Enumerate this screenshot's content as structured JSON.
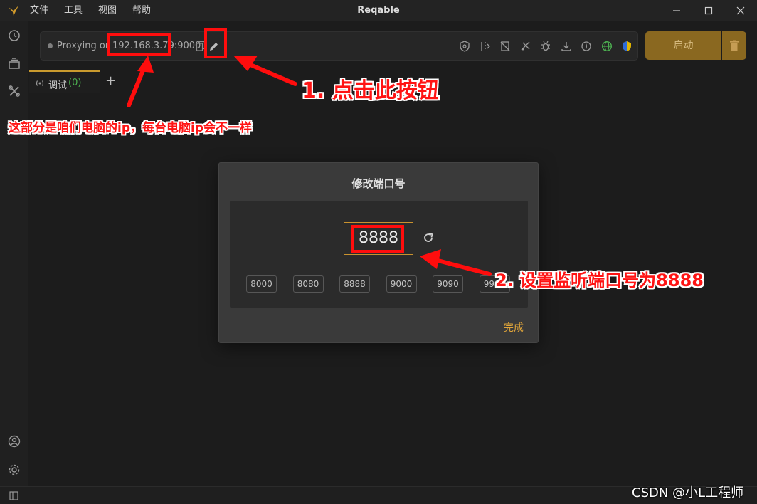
{
  "window": {
    "title": "Reqable",
    "menu": [
      "文件",
      "工具",
      "视图",
      "帮助"
    ]
  },
  "proxy": {
    "label": "Proxying on",
    "address": "192.168.3.79:9000"
  },
  "toolbar": {
    "icons": [
      "ssl-proxy-icon",
      "breakpoint-icon",
      "rewrite-icon",
      "mirror-icon",
      "debug-icon",
      "download-icon",
      "script-icon",
      "network-icon",
      "shield-icon"
    ],
    "start_label": "启动"
  },
  "tabs": [
    {
      "label": "调试",
      "count": "(0)"
    }
  ],
  "dialog": {
    "title": "修改端口号",
    "port_value": "8888",
    "presets": [
      "8000",
      "8080",
      "8888",
      "9000",
      "9090",
      "9999"
    ],
    "done_label": "完成"
  },
  "annotations": {
    "step1": "1. 点击此按钮",
    "step2": "2. 设置监听端口号为8888",
    "ip_note": "这部分是咱们电脑的ip，每台电脑ip会不一样"
  },
  "watermark": "CSDN @小L工程师",
  "colors": {
    "accent": "#c99a2e",
    "start_button": "#8a6820",
    "annotation_red": "#ff0d0d",
    "tab_count_green": "#4caf50"
  }
}
